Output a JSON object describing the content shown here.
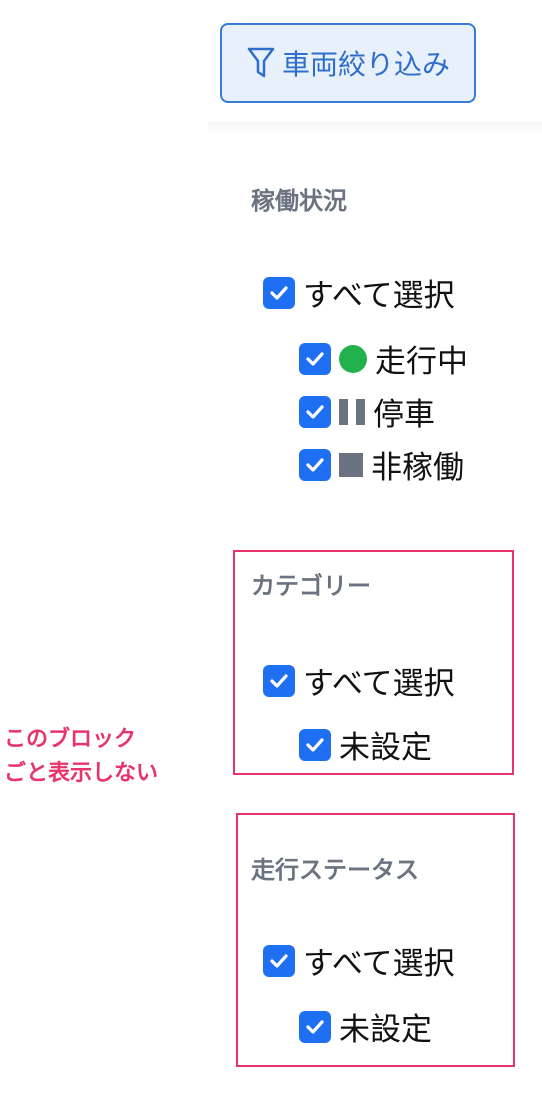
{
  "filter_button": {
    "label": "車両絞り込み",
    "icon": "funnel-icon",
    "color": "#2f6fc9"
  },
  "sections": [
    {
      "title": "稼働状況",
      "select_all": {
        "label": "すべて選択",
        "checked": true
      },
      "items": [
        {
          "label": "走行中",
          "checked": true,
          "icon": "green-dot-icon",
          "color": "#22b14c"
        },
        {
          "label": "停車",
          "checked": true,
          "icon": "pause-icon",
          "color": "#6b7280"
        },
        {
          "label": "非稼働",
          "checked": true,
          "icon": "gray-square-icon",
          "color": "#6b7280"
        }
      ]
    },
    {
      "title": "カテゴリー",
      "select_all": {
        "label": "すべて選択",
        "checked": true
      },
      "items": [
        {
          "label": "未設定",
          "checked": true
        }
      ]
    },
    {
      "title": "走行ステータス",
      "select_all": {
        "label": "すべて選択",
        "checked": true
      },
      "items": [
        {
          "label": "未設定",
          "checked": true
        }
      ]
    }
  ],
  "annotation": {
    "line1": "このブロック",
    "line2": "ごと表示しない",
    "color": "#e8336b"
  },
  "checkbox_color": "#1f6ff2"
}
